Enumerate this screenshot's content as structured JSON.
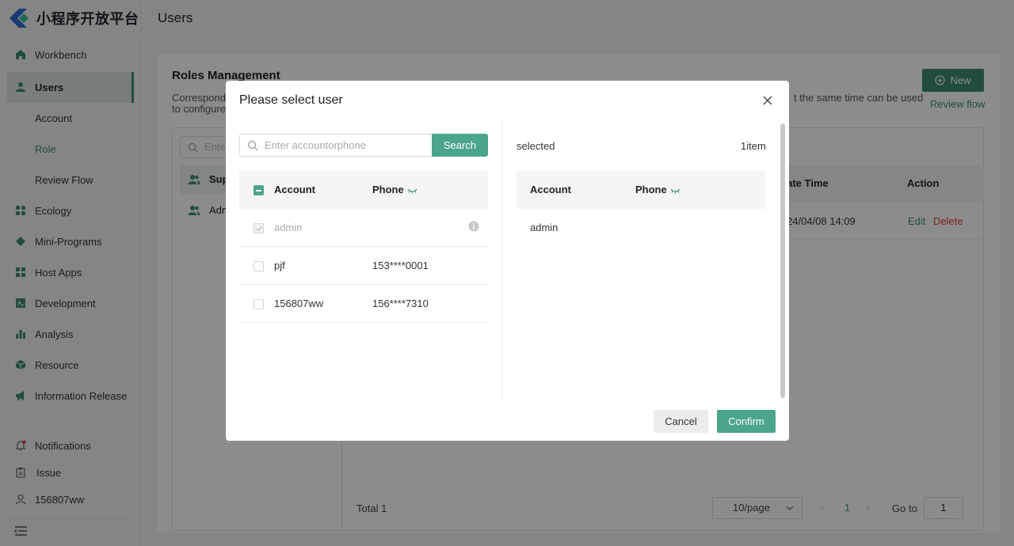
{
  "brand": {
    "name": "小程序开放平台",
    "accent": "#3d8a74",
    "logo_blue": "#2f6bd6"
  },
  "header": {
    "title": "Users"
  },
  "sidebar": {
    "items": [
      {
        "label": "Workbench",
        "icon": "home-icon"
      },
      {
        "label": "Users",
        "icon": "user-icon",
        "active": true
      },
      {
        "label": "Account",
        "sub": true
      },
      {
        "label": "Role",
        "sub": true,
        "selected": true
      },
      {
        "label": "Review Flow",
        "sub": true
      },
      {
        "label": "Ecology",
        "icon": "grid-icon"
      },
      {
        "label": "Mini-Programs",
        "icon": "diamond-icon"
      },
      {
        "label": "Host Apps",
        "icon": "apps-icon"
      },
      {
        "label": "Development",
        "icon": "terminal-icon"
      },
      {
        "label": "Analysis",
        "icon": "bar-chart-icon"
      },
      {
        "label": "Resource",
        "icon": "cube-icon"
      },
      {
        "label": "Information Release",
        "icon": "megaphone-icon"
      }
    ],
    "bottom": [
      {
        "label": "Notifications",
        "icon": "bell-icon"
      },
      {
        "label": "Issue",
        "icon": "clipboard-icon"
      },
      {
        "label": "156807ww",
        "icon": "person-icon"
      }
    ]
  },
  "card": {
    "title": "Roles Management",
    "desc_line1": "Correspond",
    "desc_line1_end": "t the same time can be used",
    "desc_line2": "to configure",
    "new_label": "New",
    "review_link": "Review flow",
    "role_search_placeholder": "Ente",
    "roles": [
      "Sup",
      "Adm"
    ],
    "table": {
      "col_time": "eate Time",
      "col_action": "Action",
      "row_time": "24/04/08 14:09",
      "edit": "Edit",
      "delete": "Delete"
    },
    "total": "Total 1",
    "page_size": "10/page",
    "page_current": "1",
    "goto_label": "Go to",
    "goto_value": "1"
  },
  "modal": {
    "title": "Please select user",
    "search_placeholder": "Enter accountorphone",
    "search_button": "Search",
    "left_headers": {
      "account": "Account",
      "phone": "Phone"
    },
    "users": [
      {
        "account": "admin",
        "phone": "",
        "checked": true,
        "disabled": true
      },
      {
        "account": "pjf",
        "phone": "153****0001",
        "checked": false,
        "disabled": false
      },
      {
        "account": "156807ww",
        "phone": "156****7310",
        "checked": false,
        "disabled": false
      }
    ],
    "selected_label": "selected",
    "selected_count": "1item",
    "right_headers": {
      "account": "Account",
      "phone": "Phone"
    },
    "selected_users": [
      {
        "account": "admin"
      }
    ],
    "cancel": "Cancel",
    "confirm": "Confirm"
  }
}
